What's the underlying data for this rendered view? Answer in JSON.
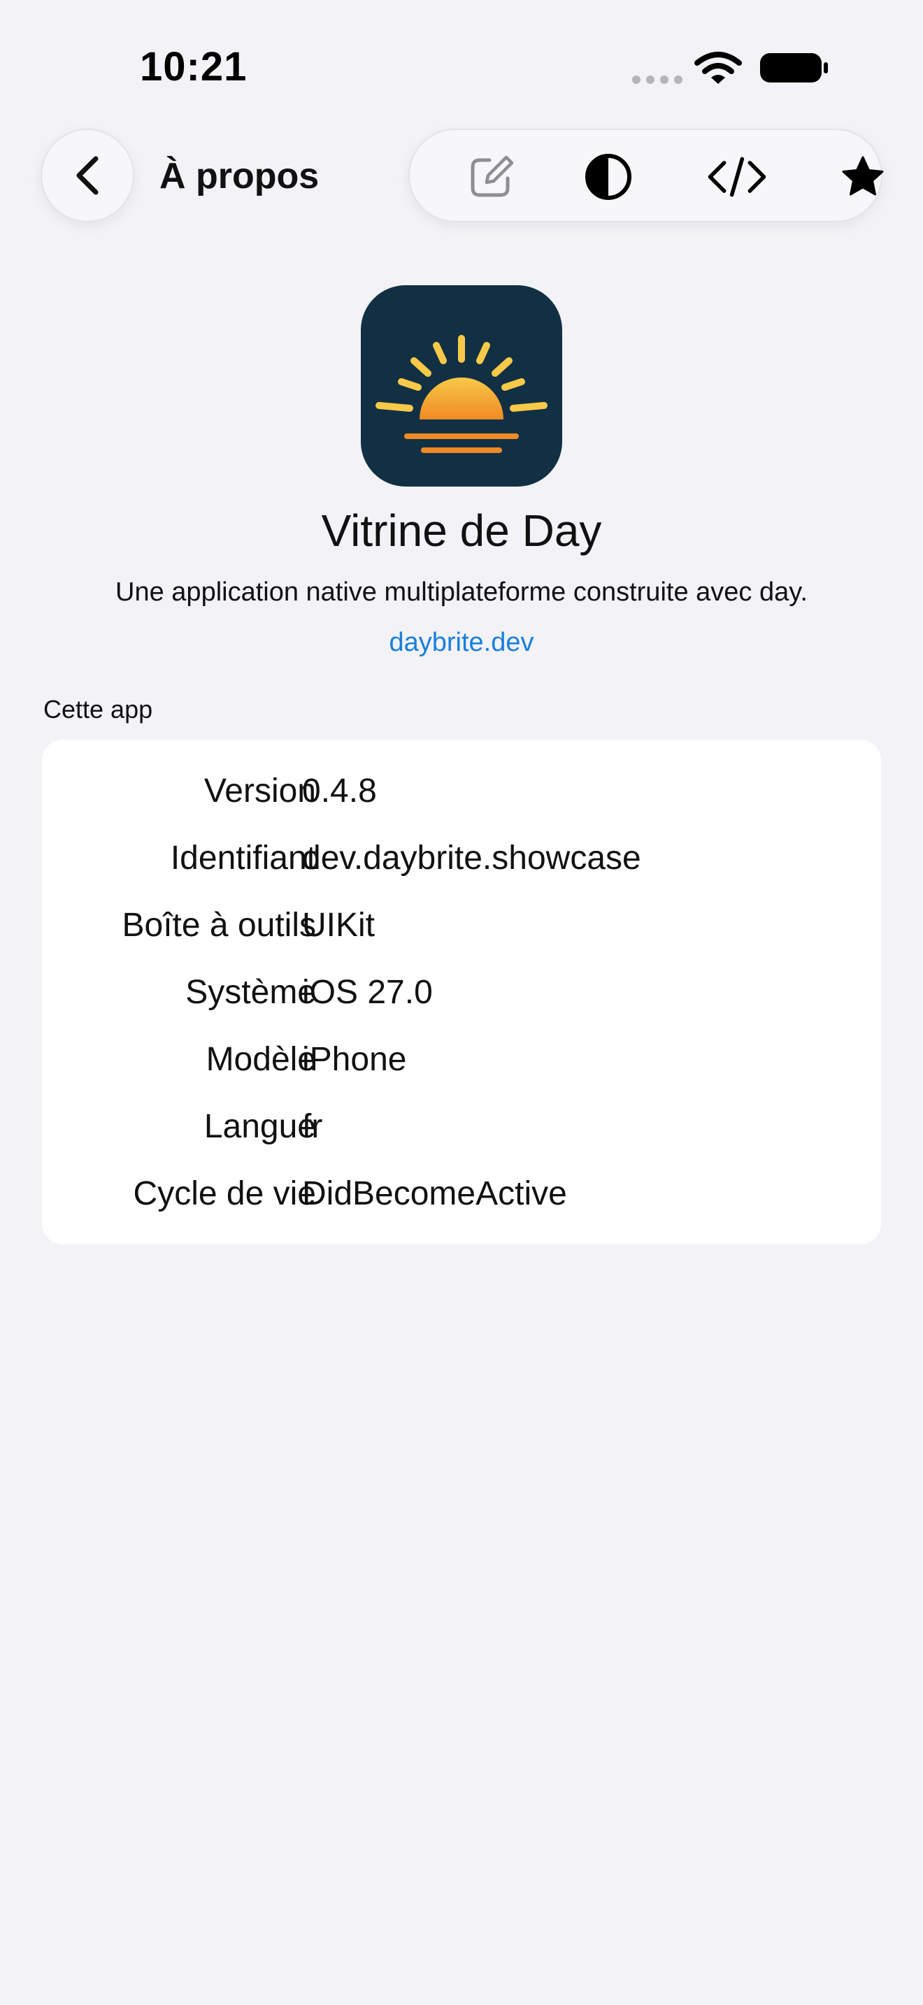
{
  "status_bar": {
    "time": "10:21",
    "icons": [
      "signal-dots-icon",
      "wifi-icon",
      "battery-icon"
    ]
  },
  "nav": {
    "back_icon": "chevron-left-icon",
    "title": "À propos",
    "toolbar_icons": [
      "edit-icon",
      "contrast-icon",
      "code-icon",
      "star-icon"
    ]
  },
  "header": {
    "app_icon": "sunrise-icon",
    "app_name": "Vitrine de Day",
    "description": "Une application native multiplateforme construite avec day.",
    "link": "daybrite.dev"
  },
  "section": {
    "title": "Cette app",
    "rows": [
      {
        "label": "Version",
        "value": "0.4.8"
      },
      {
        "label": "Identifiant",
        "value": "dev.daybrite.showcase"
      },
      {
        "label": "Boîte à outils",
        "value": "UIKit"
      },
      {
        "label": "Système",
        "value": "iOS 27.0"
      },
      {
        "label": "Modèle",
        "value": "iPhone"
      },
      {
        "label": "Langue",
        "value": "fr"
      },
      {
        "label": "Cycle de vie",
        "value": "DidBecomeActive"
      }
    ]
  },
  "colors": {
    "background": "#f2f2f7",
    "card": "#ffffff",
    "link": "#1a7fdb",
    "app_icon_bg": "#123044",
    "sun_yellow": "#f7c948",
    "sun_orange": "#f08a24"
  }
}
